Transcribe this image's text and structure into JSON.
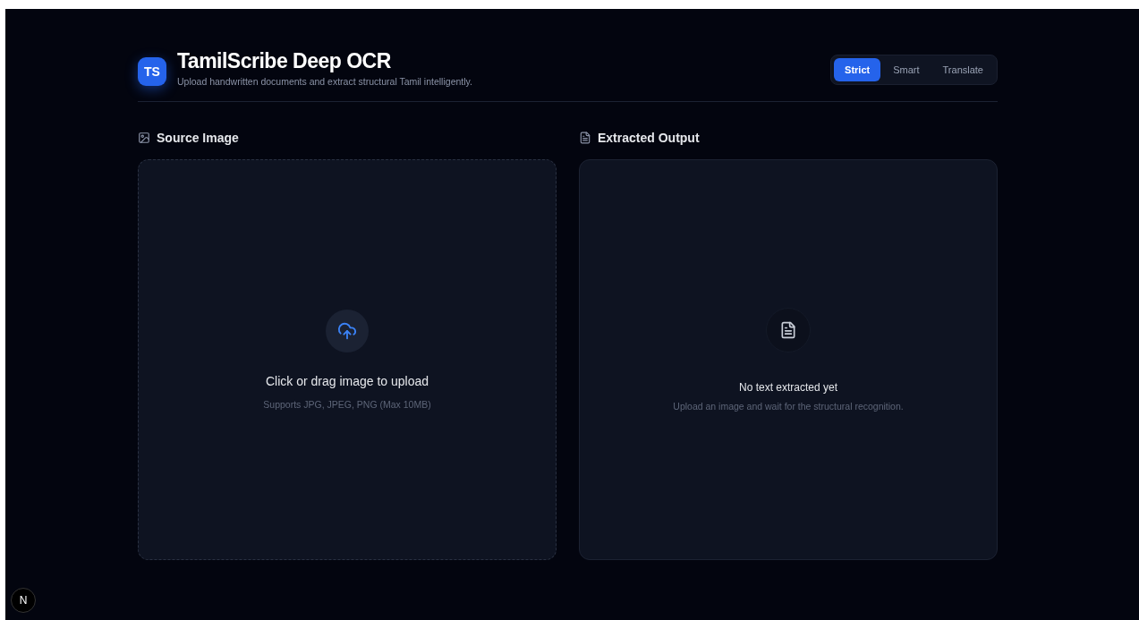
{
  "header": {
    "logo": "TS",
    "title": "TamilScribe Deep OCR",
    "subtitle": "Upload handwritten documents and extract structural Tamil intelligently."
  },
  "modes": [
    {
      "label": "Strict",
      "selected": true
    },
    {
      "label": "Smart",
      "selected": false
    },
    {
      "label": "Translate",
      "selected": false
    }
  ],
  "panels": [
    {
      "kind": "upload",
      "title": "Source Image",
      "message": "Click or drag image to upload",
      "hint": "Supports JPG, JPEG, PNG (Max 10MB)"
    },
    {
      "kind": "output",
      "title": "Extracted Output",
      "message": "No text extracted yet",
      "hint": "Upload an image and wait for the structural recognition."
    }
  ],
  "dev_badge": "N"
}
